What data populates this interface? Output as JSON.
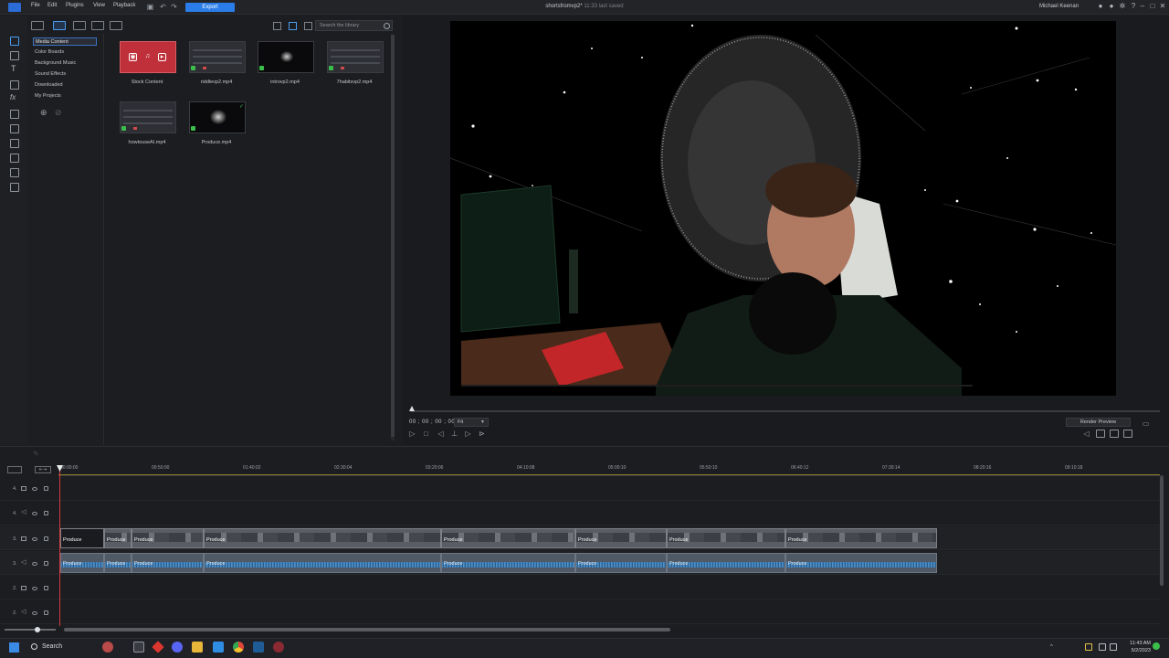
{
  "menubar": {
    "items": [
      "File",
      "Edit",
      "Plugins",
      "View",
      "Playback"
    ],
    "export_label": "Export",
    "project_title": "shortsfromvp2*",
    "saved_status": "11:33 last saved",
    "user_name": "Michael Keenan"
  },
  "library": {
    "categories": [
      "Media Content",
      "Color Boards",
      "Background Music",
      "Sound Effects",
      "Downloaded",
      "My Projects"
    ],
    "search_placeholder": "Search the library",
    "items": [
      {
        "label": "Stock Content",
        "type": "stock"
      },
      {
        "label": "riddlevp2.mp4",
        "type": "video"
      },
      {
        "label": "introvp2.mp4",
        "type": "video"
      },
      {
        "label": "7habitsvp2.mp4",
        "type": "video"
      },
      {
        "label": "howtouseAI.mp4",
        "type": "video"
      },
      {
        "label": "Produce.mp4",
        "type": "video"
      }
    ]
  },
  "preview": {
    "timecode": "00 ; 00 ; 00 ; 00",
    "fit_value": "Fit",
    "render_preview_label": "Render Preview"
  },
  "timeline": {
    "ruler_labels": [
      "00:00:00",
      "00:50:00",
      "01:40:02",
      "02:30:04",
      "03:20:06",
      "04:10:08",
      "05:00:10",
      "05:50:10",
      "06:40:12",
      "07:30:14",
      "08:20:16",
      "09:10:18"
    ],
    "tracks": [
      "4.",
      "4.",
      "3.",
      "3.",
      "2.",
      "2."
    ],
    "clip_label": "Produce"
  },
  "taskbar": {
    "search_label": "Search",
    "time": "11:43 AM",
    "date": "5/2/2023"
  },
  "colors": {
    "accent": "#2b7de9",
    "playhead": "#d6383c",
    "stock_tile": "#c0303a",
    "audio_wave": "#3f7fb8"
  }
}
